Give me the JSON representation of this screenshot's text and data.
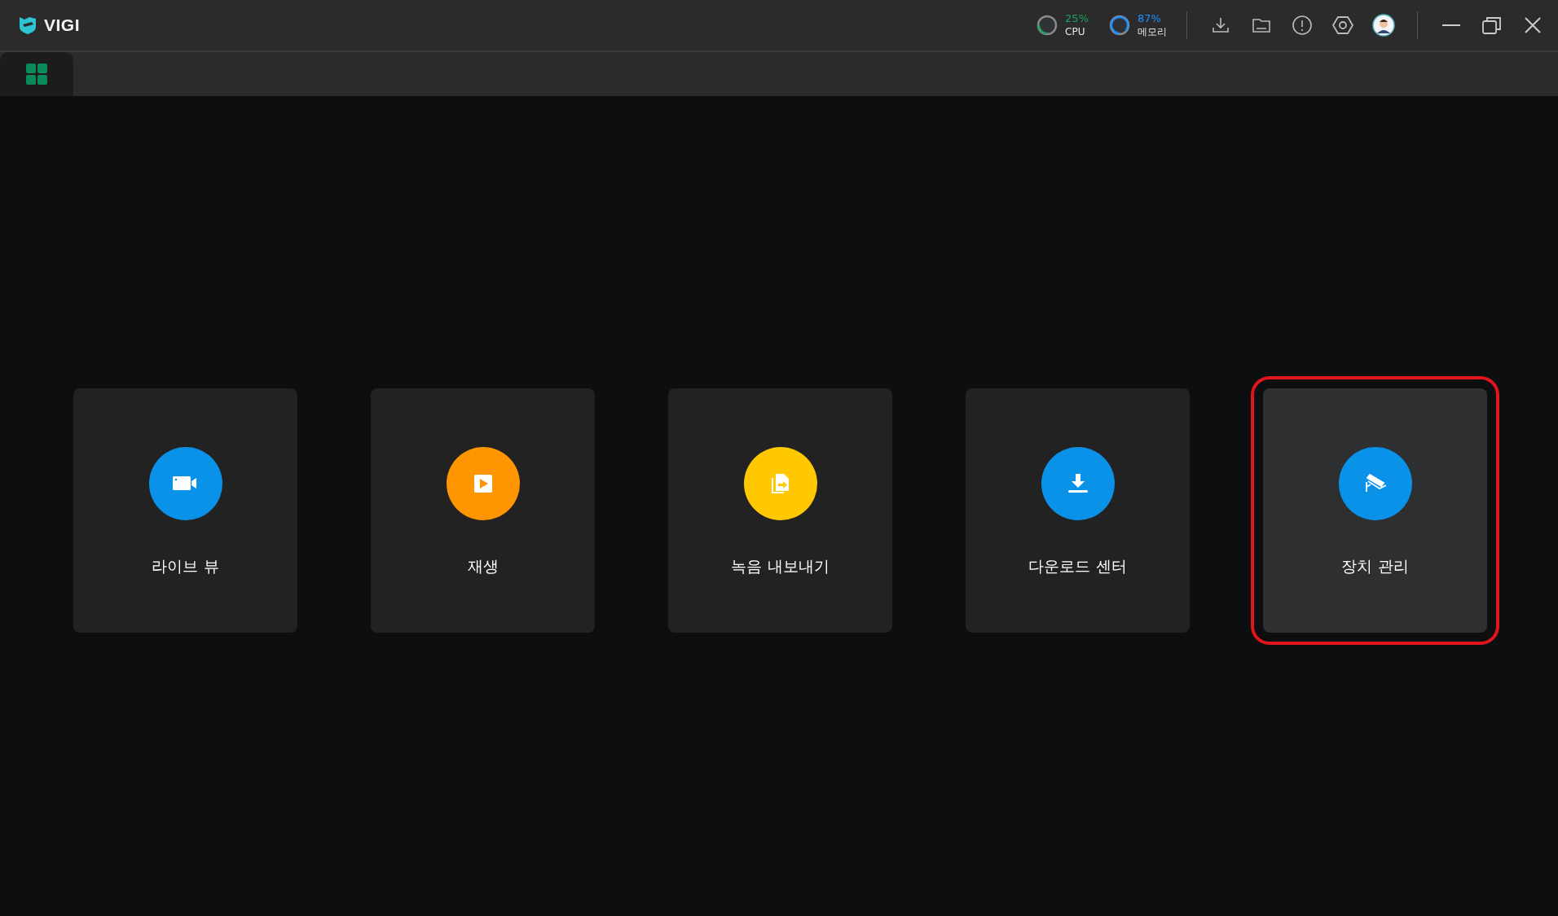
{
  "app": {
    "name": "VIGI"
  },
  "monitors": [
    {
      "reading": "25%",
      "label": "CPU",
      "level": 0.25,
      "color": "#1aa35c"
    },
    {
      "reading": "87%",
      "label": "메모리",
      "level": 0.87,
      "color": "#1e90ff"
    }
  ],
  "tabs": [
    {
      "kind": "home",
      "selected": true
    }
  ],
  "tiles": [
    {
      "kind": "live",
      "label": "라이브 뷰",
      "color": "#0a91e8",
      "highlighted": false
    },
    {
      "kind": "playback",
      "label": "재생",
      "color": "#ff9500",
      "highlighted": false
    },
    {
      "kind": "export",
      "label": "녹음 내보내기",
      "color": "#ffc800",
      "highlighted": false
    },
    {
      "kind": "download",
      "label": "다운로드 센터",
      "color": "#0a91e8",
      "highlighted": false
    },
    {
      "kind": "device",
      "label": "장치 관리",
      "color": "#0a91e8",
      "highlighted": true
    }
  ]
}
